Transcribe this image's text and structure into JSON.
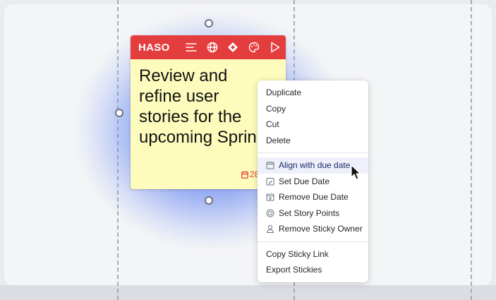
{
  "sticky": {
    "owner": "HASO",
    "text_lines": [
      "Review and",
      "refine user",
      "stories for the",
      "upcoming Sprin"
    ],
    "due_badge": "28",
    "header_color": "#e43d3d",
    "body_color": "#fdfcbc",
    "toolbar_icons": [
      "text-align-icon",
      "globe-icon",
      "diamond-icon",
      "palette-icon",
      "play-icon"
    ]
  },
  "context_menu": {
    "group1": [
      "Duplicate",
      "Copy",
      "Cut",
      "Delete"
    ],
    "group2": [
      {
        "label": "Align with due date",
        "icon": "calendar-icon",
        "hovered": true
      },
      {
        "label": "Set Due Date",
        "icon": "calendar-edit-icon"
      },
      {
        "label": "Remove Due Date",
        "icon": "calendar-remove-icon"
      },
      {
        "label": "Set Story Points",
        "icon": "story-points-icon"
      },
      {
        "label": "Remove Sticky Owner",
        "icon": "user-icon"
      }
    ],
    "group3": [
      "Copy Sticky Link",
      "Export Stickies"
    ]
  },
  "colors": {
    "selection_glow": "#4669eb",
    "hover_bg": "#eef1fb"
  }
}
